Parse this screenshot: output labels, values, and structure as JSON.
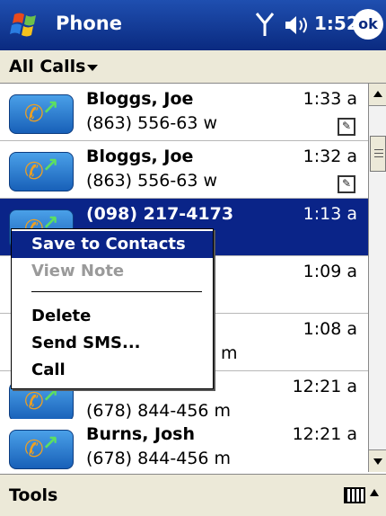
{
  "titlebar": {
    "title": "Phone",
    "time": "1:52",
    "ok_label": "ok"
  },
  "filter": {
    "label": "All Calls"
  },
  "calls": [
    {
      "name": "Bloggs, Joe",
      "number": "(863) 556-63 w",
      "time": "1:33 a",
      "has_note": true
    },
    {
      "name": "Bloggs, Joe",
      "number": "(863) 556-63 w",
      "time": "1:32 a",
      "has_note": true
    },
    {
      "name": "(098) 217-4173",
      "number": "",
      "time": "1:13 a",
      "selected": true
    },
    {
      "name": "73",
      "number": "",
      "time": "1:09 a"
    },
    {
      "name": "",
      "number": "m",
      "time": "1:08 a"
    },
    {
      "name": "",
      "number": "(678) 844-456 m",
      "time": "12:21 a"
    },
    {
      "name": "Burns, Josh",
      "number": "(678) 844-456 m",
      "time": "12:21 a"
    }
  ],
  "context_menu": {
    "items": [
      "Save to Contacts",
      "View Note",
      "Delete",
      "Send SMS...",
      "Call"
    ]
  },
  "bottombar": {
    "tools_label": "Tools"
  },
  "colors": {
    "selection": "#0a2488",
    "titlebar": "#0a2a80",
    "bar_bg": "#ece9d8"
  }
}
